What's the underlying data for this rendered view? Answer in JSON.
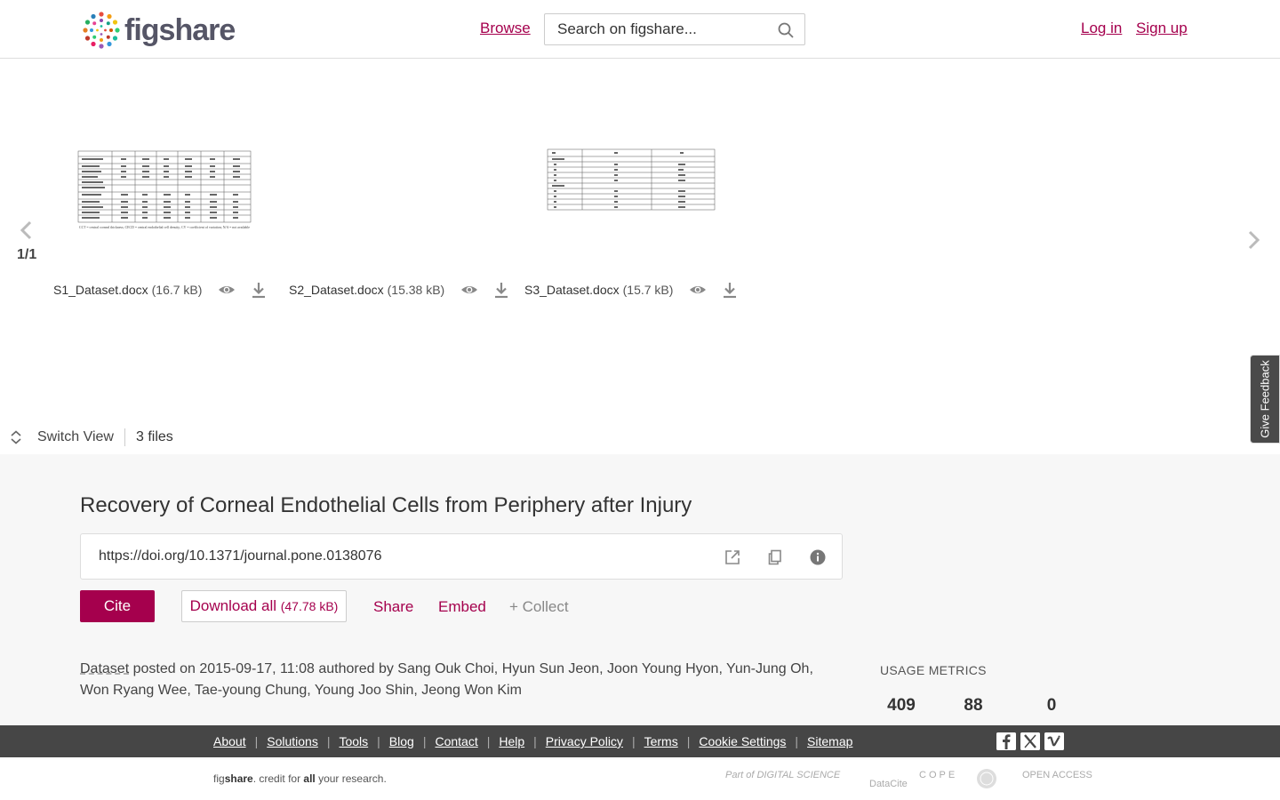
{
  "header": {
    "logo_text": "figshare",
    "browse": "Browse",
    "search_placeholder": "Search on figshare...",
    "login": "Log in",
    "signup": "Sign up"
  },
  "carousel": {
    "page_indicator": "1/1",
    "files": [
      {
        "name": "S1_Dataset.docx",
        "size": "(16.7 kB)"
      },
      {
        "name": "S2_Dataset.docx",
        "size": "(15.38 kB)"
      },
      {
        "name": "S3_Dataset.docx",
        "size": "(15.7 kB)"
      }
    ],
    "thumb1_footnote": "CCT = central corneal thickness; CECD = central endothelial cell density; CV = coefficient of variation; N/A = not available",
    "switch_view": "Switch View",
    "files_count": "3 files",
    "feedback": "Give Feedback"
  },
  "article": {
    "title": "Recovery of Corneal Endothelial Cells from Periphery after Injury",
    "doi": "https://doi.org/10.1371/journal.pone.0138076",
    "cite": "Cite",
    "download_all": "Download all",
    "download_size": "(47.78 kB)",
    "share": "Share",
    "embed": "Embed",
    "collect": "+ Collect",
    "item_type": "Dataset",
    "posted_text": " posted on 2015-09-17, 11:08 authored by Sang Ouk Choi, Hyun Sun Jeon, Joon Young Hyon, Yun-Jung Oh, Won Ryang Wee, Tae-young Chung, Young Joo Shin, Jeong Won Kim"
  },
  "usage": {
    "label": "USAGE METRICS",
    "values": [
      "409",
      "88",
      "0"
    ]
  },
  "footer": {
    "links": [
      "About",
      "Solutions",
      "Tools",
      "Blog",
      "Contact",
      "Help",
      "Privacy Policy",
      "Terms",
      "Cookie Settings",
      "Sitemap"
    ],
    "tagline_fig": "fig",
    "tagline_share": "share",
    "tagline_rest1": ". credit for ",
    "tagline_all": "all",
    "tagline_rest2": " your research.",
    "partners": [
      "Part of DIGITAL SCIENCE",
      "DataCite",
      "COPE",
      "OPEN ACCESS"
    ]
  },
  "colors": {
    "brand": "#a5004d",
    "footer_dark": "#464646",
    "main_bg": "#f7f7f7"
  }
}
